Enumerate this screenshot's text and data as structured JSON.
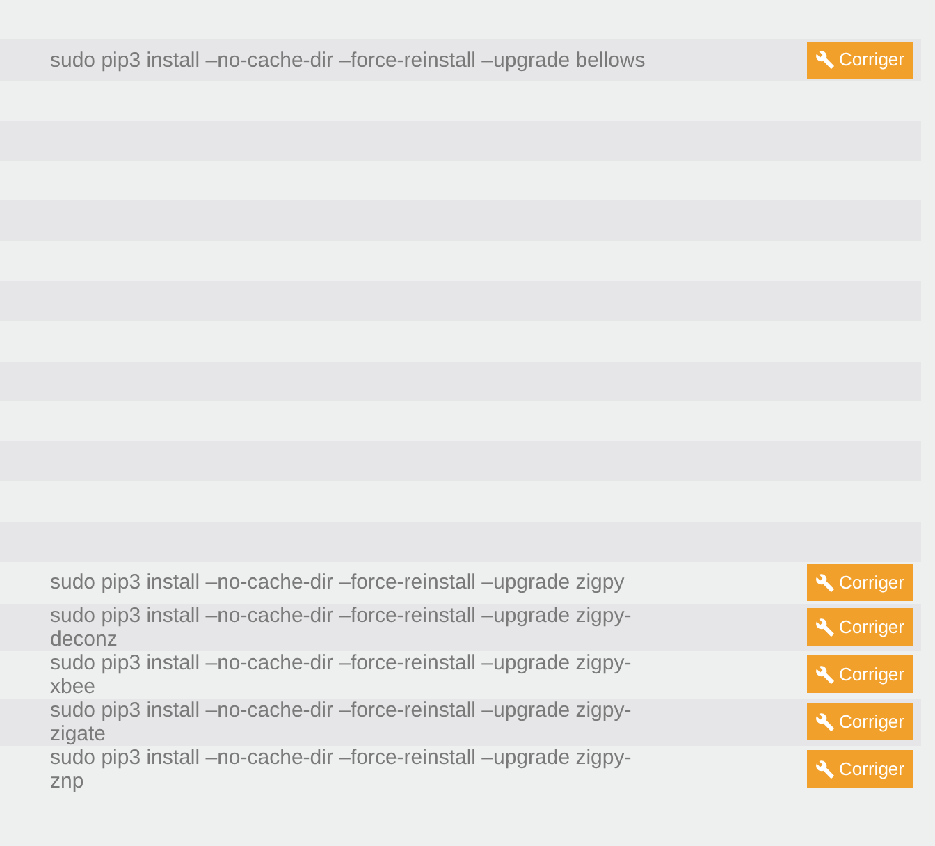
{
  "rows": [
    {
      "kind": "command",
      "command": "sudo pip3 install –no-cache-dir –force-reinstall –upgrade bellows",
      "button": "Corriger"
    },
    {
      "kind": "empty"
    },
    {
      "kind": "empty"
    },
    {
      "kind": "empty"
    },
    {
      "kind": "empty"
    },
    {
      "kind": "empty"
    },
    {
      "kind": "empty"
    },
    {
      "kind": "empty"
    },
    {
      "kind": "empty"
    },
    {
      "kind": "empty"
    },
    {
      "kind": "empty"
    },
    {
      "kind": "empty"
    },
    {
      "kind": "empty"
    },
    {
      "kind": "command",
      "command": "sudo pip3 install –no-cache-dir –force-reinstall –upgrade zigpy",
      "button": "Corriger"
    },
    {
      "kind": "command",
      "command": "sudo pip3 install –no-cache-dir –force-reinstall –upgrade zigpy-deconz",
      "button": "Corriger"
    },
    {
      "kind": "command",
      "command": "sudo pip3 install –no-cache-dir –force-reinstall –upgrade zigpy-xbee",
      "button": "Corriger"
    },
    {
      "kind": "command",
      "command": "sudo pip3 install –no-cache-dir –force-reinstall –upgrade zigpy-zigate",
      "button": "Corriger"
    },
    {
      "kind": "command",
      "command": "sudo pip3 install –no-cache-dir –force-reinstall –upgrade zigpy-znp",
      "button": "Corriger"
    }
  ]
}
